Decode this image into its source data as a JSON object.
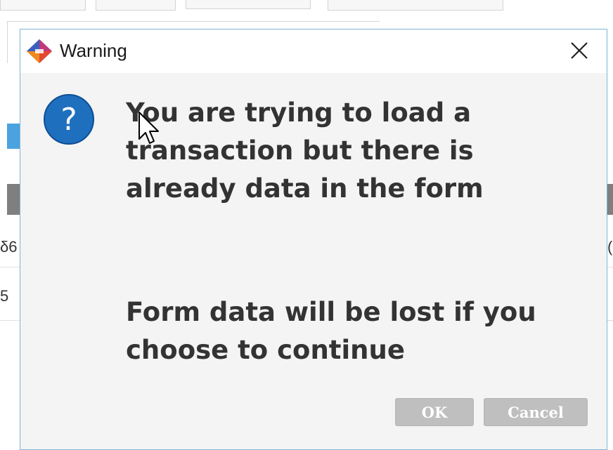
{
  "background": {
    "row_fragments": [
      {
        "left": "δ6",
        "right": "("
      },
      {
        "left": "5",
        "right": ""
      }
    ]
  },
  "dialog": {
    "title": "Warning",
    "message_line1": "You are trying to load a transaction but there is already data in the form",
    "message_line2": "Form data will be lost if you choose to continue",
    "ok_label": "OK",
    "cancel_label": "Cancel",
    "icon_question": "?"
  },
  "colors": {
    "accent_blue": "#1f6fbf",
    "button_gray": "#bfbfbf",
    "dialog_bg": "#f4f4f4"
  },
  "icons": {
    "app": "app-logo-icon",
    "close": "close-icon",
    "question": "question-icon"
  }
}
